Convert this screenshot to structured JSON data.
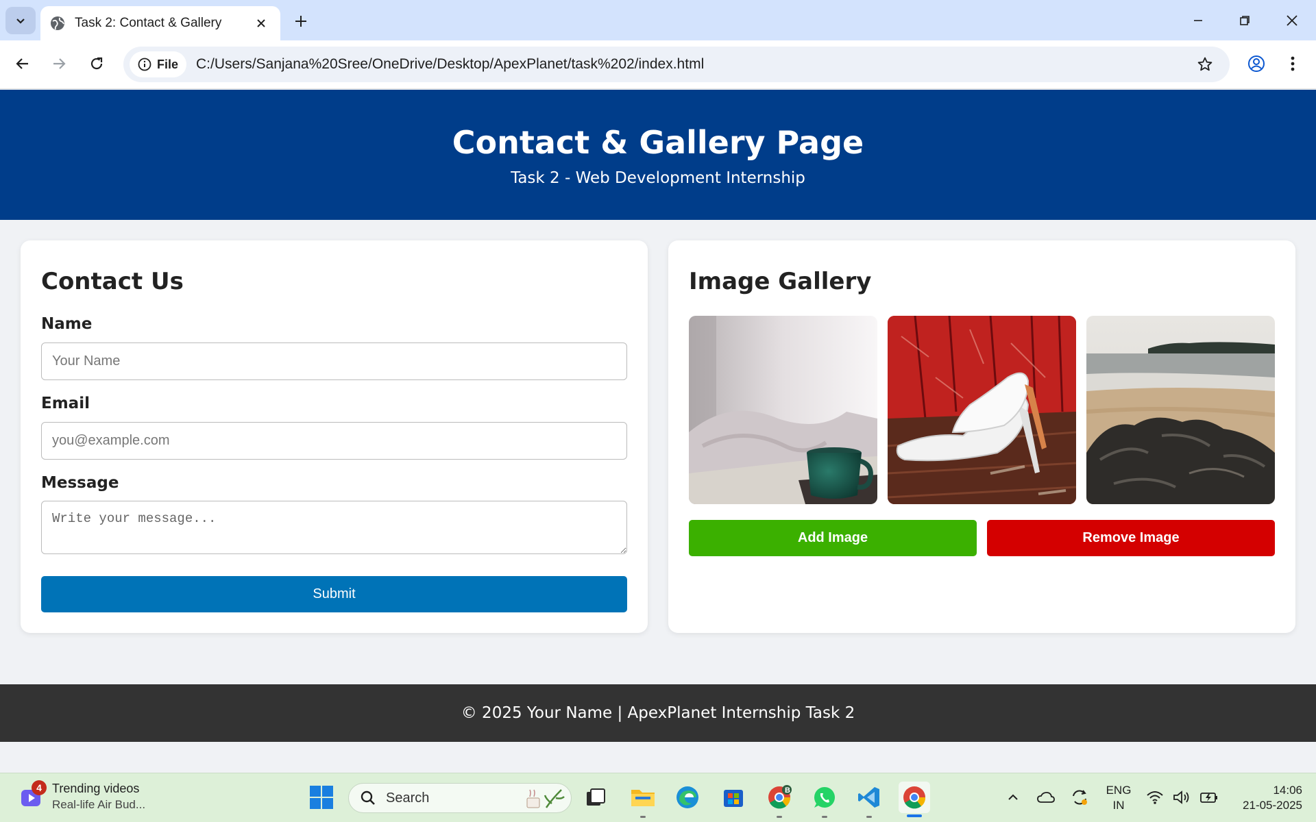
{
  "browser": {
    "tab_title": "Task 2: Contact & Gallery",
    "file_chip": "File",
    "url": "C:/Users/Sanjana%20Sree/OneDrive/Desktop/ApexPlanet/task%202/index.html"
  },
  "header": {
    "title": "Contact & Gallery Page",
    "subtitle": "Task 2 - Web Development Internship"
  },
  "contact": {
    "heading": "Contact Us",
    "name_label": "Name",
    "name_placeholder": "Your Name",
    "email_label": "Email",
    "email_placeholder": "you@example.com",
    "message_label": "Message",
    "message_placeholder": "Write your message...",
    "submit_label": "Submit",
    "submit_color": "#0073b7"
  },
  "gallery": {
    "heading": "Image Gallery",
    "images": [
      "coffee-mug-photo",
      "white-high-heels-photo",
      "beach-rocks-photo"
    ],
    "add_label": "Add Image",
    "add_color": "#3bb000",
    "remove_label": "Remove Image",
    "remove_color": "#d40000"
  },
  "footer": {
    "text": "© 2025 Your Name | ApexPlanet Internship Task 2"
  },
  "taskbar": {
    "widget_badge": "4",
    "widget_title": "Trending videos",
    "widget_subtitle": "Real-life Air Bud...",
    "search_label": "Search",
    "lang_line1": "ENG",
    "lang_line2": "IN",
    "time": "14:06",
    "date": "21-05-2025",
    "chrome_badge": "B"
  },
  "colors": {
    "header_bg": "#003d8a",
    "footer_bg": "#333333",
    "page_bg": "#f0f2f5"
  }
}
